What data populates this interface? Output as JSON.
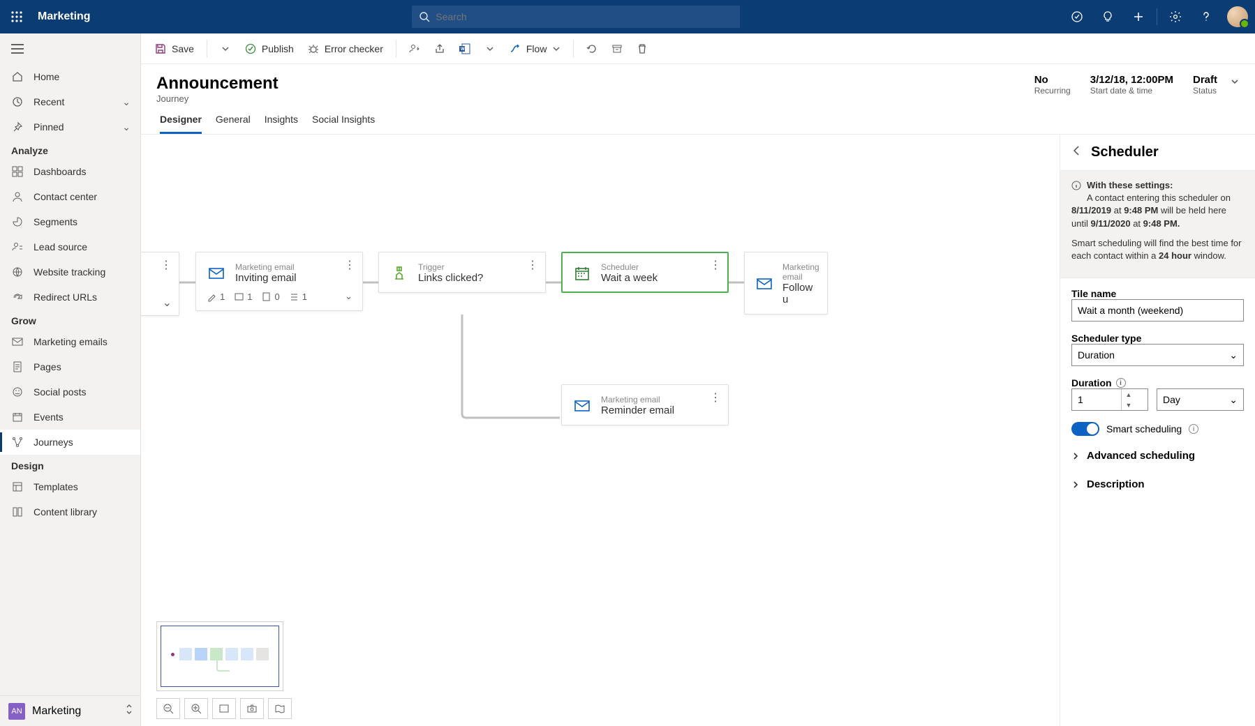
{
  "topbar": {
    "app": "Marketing",
    "searchPlaceholder": "Search"
  },
  "sidebar": {
    "pinned": [
      {
        "label": "Home"
      },
      {
        "label": "Recent",
        "expandable": true
      },
      {
        "label": "Pinned",
        "expandable": true
      }
    ],
    "groups": {
      "analyze": {
        "title": "Analyze",
        "items": [
          "Dashboards",
          "Contact center",
          "Segments",
          "Lead source",
          "Website tracking",
          "Redirect URLs"
        ]
      },
      "grow": {
        "title": "Grow",
        "items": [
          "Marketing emails",
          "Pages",
          "Social posts",
          "Events",
          "Journeys"
        ]
      },
      "design": {
        "title": "Design",
        "items": [
          "Templates",
          "Content library"
        ]
      }
    },
    "footer": {
      "badge": "AN",
      "label": "Marketing"
    }
  },
  "commandBar": {
    "save": "Save",
    "publish": "Publish",
    "errorChecker": "Error checker",
    "flow": "Flow"
  },
  "record": {
    "title": "Announcement",
    "entity": "Journey",
    "meta": [
      {
        "value": "No",
        "label": "Recurring"
      },
      {
        "value": "3/12/18, 12:00PM",
        "label": "Start date & time"
      },
      {
        "value": "Draft",
        "label": "Status"
      }
    ],
    "tabs": [
      "Designer",
      "General",
      "Insights",
      "Social Insights"
    ],
    "activeTab": 0
  },
  "canvas": {
    "tiles": {
      "partialLeft": {
        "hasMenu": true
      },
      "email1": {
        "type": "Marketing email",
        "title": "Inviting email",
        "stats": [
          1,
          1,
          0,
          1
        ]
      },
      "trigger": {
        "type": "Trigger",
        "title": "Links clicked?"
      },
      "scheduler": {
        "type": "Scheduler",
        "title": "Wait a week"
      },
      "email2": {
        "type": "Marketing email",
        "title": "Follow u"
      },
      "reminder": {
        "type": "Marketing email",
        "title": "Reminder email"
      }
    }
  },
  "panel": {
    "title": "Scheduler",
    "infoHeader": "With these settings:",
    "infoLine1a": "A contact entering this scheduler on ",
    "info_date1": "8/11/2019",
    "info_at": " at ",
    "info_time1": "9:48 PM",
    "infoLine1b": " will be held here until ",
    "info_date2": "9/11/2020",
    "info_time2": "9:48 PM.",
    "infoLine2a": "Smart scheduling will find the best time for each contact within a ",
    "info_window": "24 hour",
    "infoLine2b": " window.",
    "fields": {
      "tileNameLabel": "Tile name",
      "tileNameValue": "Wait a month (weekend)",
      "schedulerTypeLabel": "Scheduler type",
      "schedulerTypeValue": "Duration",
      "durationLabel": "Duration",
      "durationValue": "1",
      "durationUnit": "Day",
      "smartLabel": "Smart scheduling",
      "advanced": "Advanced scheduling",
      "description": "Description"
    }
  }
}
